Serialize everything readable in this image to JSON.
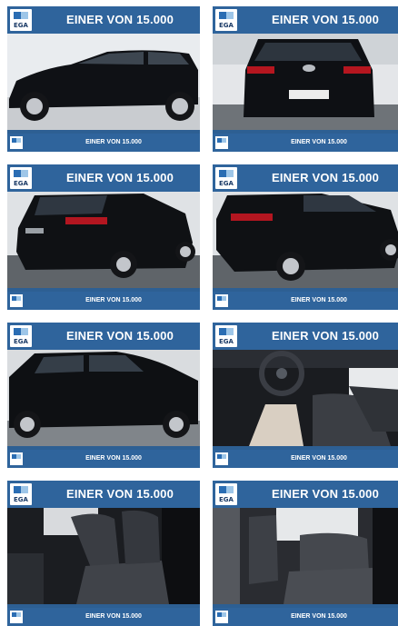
{
  "gallery": {
    "tiles": [
      {
        "banner": "EINER VON 15.000",
        "logo": "EGA",
        "caption": "EINER VON 15.000",
        "view": "side-left"
      },
      {
        "banner": "EINER VON 15.000",
        "logo": "EGA",
        "caption": "EINER VON 15.000",
        "view": "rear"
      },
      {
        "banner": "EINER VON 15.000",
        "logo": "EGA",
        "caption": "EINER VON 15.000",
        "view": "rear-left"
      },
      {
        "banner": "EINER VON 15.000",
        "logo": "EGA",
        "caption": "EINER VON 15.000",
        "view": "rear-right"
      },
      {
        "banner": "EINER VON 15.000",
        "logo": "EGA",
        "caption": "EINER VON 15.000",
        "view": "side-right"
      },
      {
        "banner": "EINER VON 15.000",
        "logo": "EGA",
        "caption": "EINER VON 15.000",
        "view": "cockpit"
      },
      {
        "banner": "EINER VON 15.000",
        "logo": "EGA",
        "caption": "EINER VON 15.000",
        "view": "front-seats"
      },
      {
        "banner": "EINER VON 15.000",
        "logo": "EGA",
        "caption": "EINER VON 15.000",
        "view": "rear-seats"
      }
    ]
  },
  "colors": {
    "banner": "#2f649c",
    "car": "#0d0e12",
    "background": "#ffffff"
  }
}
